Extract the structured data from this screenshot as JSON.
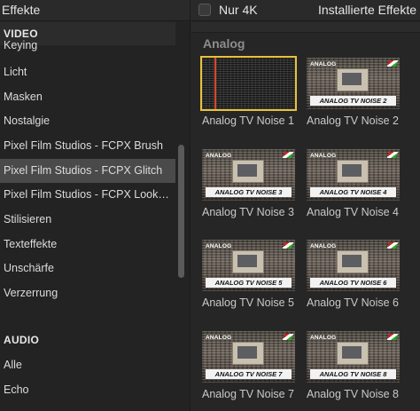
{
  "header": {
    "title": "Effekte",
    "checkbox_label": "Nur 4K",
    "installed_label": "Installierte Effekte"
  },
  "sidebar": {
    "video_heading": "VIDEO",
    "items": [
      {
        "label": "Keying",
        "selected": false
      },
      {
        "label": "Licht",
        "selected": false
      },
      {
        "label": "Masken",
        "selected": false
      },
      {
        "label": "Nostalgie",
        "selected": false
      },
      {
        "label": "Pixel Film Studios - FCPX Brush",
        "selected": false
      },
      {
        "label": "Pixel Film Studios - FCPX Glitch",
        "selected": true
      },
      {
        "label": "Pixel Film Studios - FCPX Look…",
        "selected": false
      },
      {
        "label": "Stilisieren",
        "selected": false
      },
      {
        "label": "Texteffekte",
        "selected": false
      },
      {
        "label": "Unschärfe",
        "selected": false
      },
      {
        "label": "Verzerrung",
        "selected": false
      }
    ],
    "audio_heading": "AUDIO",
    "audio_items": [
      {
        "label": "Alle"
      },
      {
        "label": "Echo"
      }
    ]
  },
  "content": {
    "group_title": "Analog",
    "tiles": [
      {
        "label": "Analog TV Noise 1",
        "tag": "",
        "banner": "",
        "selected": true
      },
      {
        "label": "Analog TV Noise 2",
        "tag": "ANALOG",
        "banner": "ANALOG TV NOISE 2",
        "selected": false
      },
      {
        "label": "Analog TV Noise 3",
        "tag": "ANALOG",
        "banner": "ANALOG TV NOISE 3",
        "selected": false
      },
      {
        "label": "Analog TV Noise 4",
        "tag": "ANALOG",
        "banner": "ANALOG TV NOISE 4",
        "selected": false
      },
      {
        "label": "Analog TV Noise 5",
        "tag": "ANALOG",
        "banner": "ANALOG TV NOISE 5",
        "selected": false
      },
      {
        "label": "Analog TV Noise 6",
        "tag": "ANALOG",
        "banner": "ANALOG TV NOISE 6",
        "selected": false
      },
      {
        "label": "Analog TV Noise 7",
        "tag": "ANALOG",
        "banner": "ANALOG TV NOISE 7",
        "selected": false
      },
      {
        "label": "Analog TV Noise 8",
        "tag": "ANALOG",
        "banner": "ANALOG TV NOISE 8",
        "selected": false
      }
    ]
  },
  "colors": {
    "selection_outline": "#e8c23a",
    "sidebar_selected": "#4a4a4a"
  }
}
